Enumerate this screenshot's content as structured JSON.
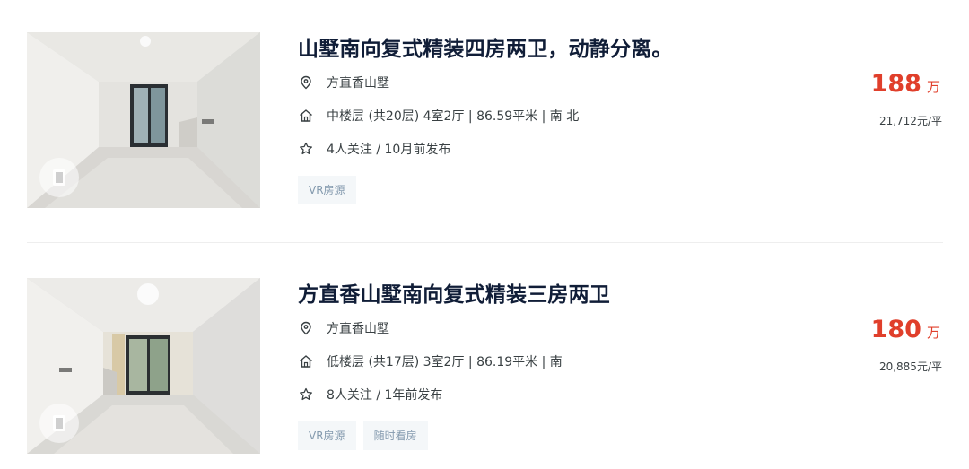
{
  "listings": [
    {
      "title": "山墅南向复式精装四房两卫，动静分离。",
      "community": "方直香山墅",
      "info": "中楼层 (共20层) 4室2厅 | 86.59平米 | 南 北",
      "follow": "4人关注 / 10月前发布",
      "tags": [
        "VR房源"
      ],
      "price": "188",
      "price_unit": "万",
      "unit_price": "21,712元/平"
    },
    {
      "title": "方直香山墅南向复式精装三房两卫",
      "community": "方直香山墅",
      "info": "低楼层 (共17层) 3室2厅 | 86.19平米 | 南",
      "follow": "8人关注 / 1年前发布",
      "tags": [
        "VR房源",
        "随时看房"
      ],
      "price": "180",
      "price_unit": "万",
      "unit_price": "20,885元/平"
    }
  ],
  "icons": {
    "community": "location-pin-icon",
    "info": "house-icon",
    "follow": "star-outline-icon",
    "vr": "vr-panorama-icon"
  },
  "colors": {
    "title": "#101d37",
    "price": "#e03f2b",
    "tag_text": "#849aae",
    "tag_bg": "#f4f7f9"
  }
}
